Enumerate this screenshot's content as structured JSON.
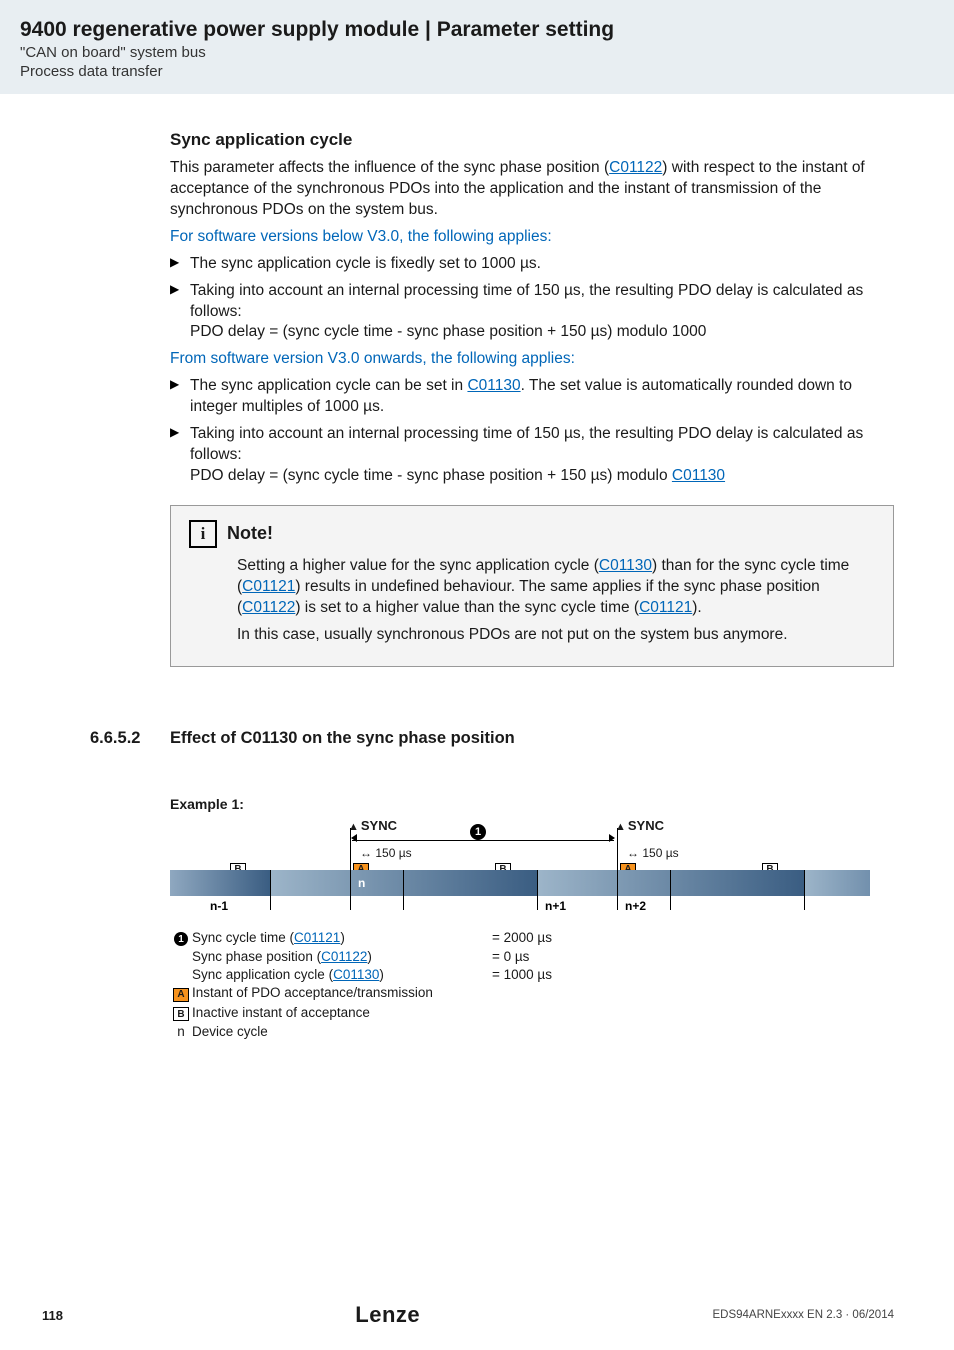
{
  "header": {
    "title": "9400 regenerative power supply module | Parameter setting",
    "sub1": "\"CAN on board\" system bus",
    "sub2": "Process data transfer"
  },
  "s1": {
    "h": "Sync application cycle",
    "para1a": "This parameter affects the influence of the sync phase position (",
    "link1": "C01122",
    "para1b": ") with respect to the instant of acceptance of the synchronous PDOs into the application and the instant of transmission of the synchronous PDOs on the system bus.",
    "subA": "For software versions below V3.0, the following applies:",
    "b1": "The sync application cycle is fixedly set to 1000 µs.",
    "b2a": "Taking into account an internal processing time of 150 µs, the resulting PDO delay is calculated as follows:",
    "b2b": "PDO delay = (sync cycle time - sync phase position + 150 µs) modulo 1000",
    "subB": "From software version V3.0 onwards, the following applies:",
    "b3a": "The sync application cycle can be set in ",
    "b3link": "C01130",
    "b3b": ". The set value is automatically rounded down to integer multiples of 1000 µs.",
    "b4a": "Taking into account an internal processing time of 150 µs, the resulting PDO delay is calculated as follows:",
    "b4b_pre": "PDO delay = (sync cycle time - sync phase position + 150 µs) modulo ",
    "b4link": "C01130"
  },
  "note": {
    "title": "Note!",
    "p1a": "Setting a higher value for the sync application cycle (",
    "l1": "C01130",
    "p1b": ") than for the sync cycle time (",
    "l2": "C01121",
    "p1c": ") results in undefined behaviour. The same applies if the sync phase position (",
    "l3": "C01122",
    "p1d": ") is set to a higher value than the sync cycle time (",
    "l4": "C01121",
    "p1e": ").",
    "p2": "In this case, usually synchronous PDOs are not put on the system bus anymore."
  },
  "sec2": {
    "num": "6.6.5.2",
    "title": "Effect of C01130 on the sync phase position"
  },
  "ex": {
    "label": "Example 1:",
    "sync": "SYNC",
    "t150": "150 µs",
    "nm1": "n-1",
    "n": "n",
    "np1": "n+1",
    "np2": "n+2",
    "A": "A",
    "B": "B"
  },
  "legend": {
    "r1": {
      "lbl_a": "Sync cycle time (",
      "link": "C01121",
      "lbl_b": ")",
      "val": "= 2000 µs"
    },
    "r2": {
      "lbl_a": "Sync phase position (",
      "link": "C01122",
      "lbl_b": ")",
      "val": "= 0 µs"
    },
    "r3": {
      "lbl_a": "Sync application cycle (",
      "link": "C01130",
      "lbl_b": ")",
      "val": "= 1000 µs"
    },
    "r4": "Instant of PDO acceptance/transmission",
    "r5": "Inactive instant of acceptance",
    "r6sym": "n",
    "r6": "Device cycle"
  },
  "footer": {
    "page": "118",
    "logo": "Lenze",
    "doc": "EDS94ARNExxxx EN 2.3 · 06/2014"
  }
}
